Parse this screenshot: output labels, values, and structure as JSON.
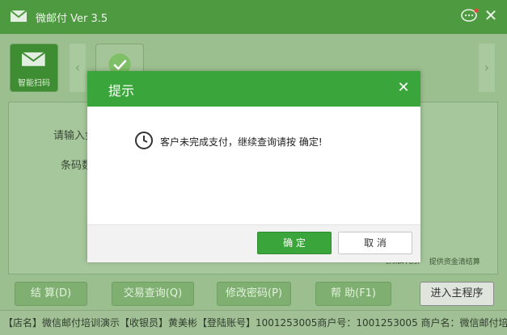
{
  "window": {
    "title": "微邮付 Ver 3.5"
  },
  "toolbar": {
    "smart_scan_label": "智能扫码",
    "prev_arrow": "‹",
    "next_arrow": "›"
  },
  "form": {
    "amount_label": "请输入金",
    "barcode_label": "条码数"
  },
  "postal": {
    "brand": "CHINA POST",
    "slogan": "提供资金清结算"
  },
  "buttons": {
    "settle": "结 算(D)",
    "query": "交易查询(Q)",
    "change_pwd": "修改密码(P)",
    "help": "帮 助(F1)",
    "enter_main": "进入主程序"
  },
  "status": {
    "text": "【店名】微信邮付培训演示【收银员】黄美彬【登陆账号】1001253005商户号：1001253005 商户名：微信邮付培训"
  },
  "dialog": {
    "title": "提示",
    "message": "客户未完成支付，继续查询请按 确定!",
    "ok": "确 定",
    "cancel": "取 消"
  },
  "colors": {
    "accent_green": "#3aa53a",
    "title_green": "#4d9a40",
    "background_overlay": "#9bbf8e"
  }
}
